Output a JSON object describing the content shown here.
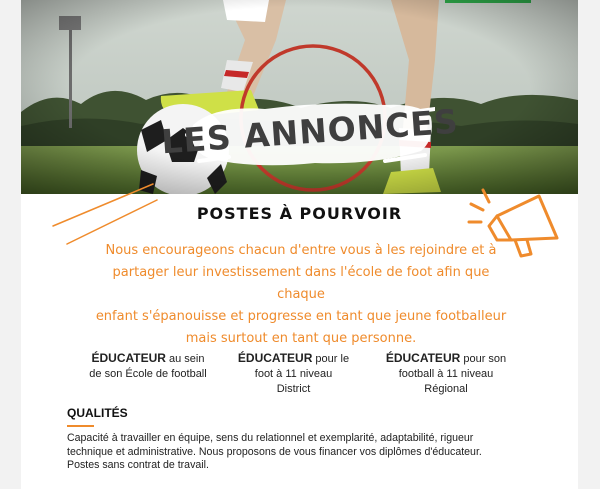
{
  "hero": {
    "title": "LES ANNONCES",
    "image_icon": "football-player-photo"
  },
  "section": {
    "title": "POSTES À POURVOIR"
  },
  "intro": {
    "line1": "Nous encourageons chacun d'entre vous à les rejoindre et à",
    "line2": "partager leur investissement dans l'école de foot afin que chaque",
    "line3": "enfant s'épanouisse et progresse en tant que jeune footballeur",
    "line4": "mais surtout en tant que personne."
  },
  "positions": [
    {
      "role": "ÉDUCATEUR",
      "line1": " au sein",
      "line2": "de son École de football",
      "line3": ""
    },
    {
      "role": "ÉDUCATEUR",
      "line1": " pour le",
      "line2": "foot à 11 niveau",
      "line3": "District"
    },
    {
      "role": "ÉDUCATEUR",
      "line1": " pour son",
      "line2": "football à 11 niveau",
      "line3": "Régional"
    }
  ],
  "qualities": {
    "heading": "QUALITÉS",
    "line1": "Capacité à travailler en équipe, sens du relationnel et exemplarité, adaptabilité, rigueur",
    "line2": "technique et administrative. Nous proposons de vous financer vos diplômes d'éducateur.",
    "line3": "Postes sans contrat de travail."
  },
  "icons": {
    "megaphone": "megaphone-icon",
    "deco": "decorative-lines"
  },
  "colors": {
    "accent": "#ef8b2c",
    "hero_ring": "#c0392b",
    "text": "#222222"
  }
}
